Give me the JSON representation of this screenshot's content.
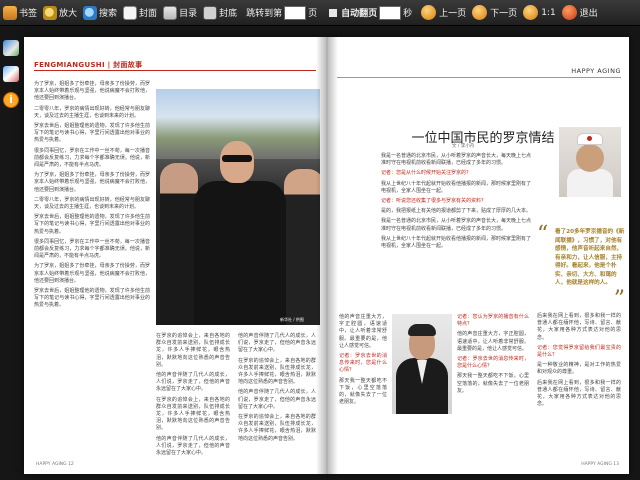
{
  "toolbar": {
    "bookmark": "书签",
    "zoom": "放大",
    "search": "搜索",
    "front_cover": "封面",
    "toc": "目录",
    "back_cover": "封底",
    "jump_to": "跳转到第",
    "page_value": "",
    "page_unit": "页",
    "auto_flip": "自动翻页",
    "auto_value": "",
    "seconds_unit": "秒",
    "prev": "上一页",
    "next": "下一页",
    "ratio": "1:1",
    "exit": "退出"
  },
  "rail": {
    "info": "i"
  },
  "left_page": {
    "header": "FENGMIANGUSHI | 封面故事",
    "col1": [
      "为了罗京，姐姐多了份牵挂，母亲多了份操劳，而罗京本人始终带着乐观与坚强，他说病魔不会打败他，他还要回到演播台。",
      "二零零八年，罗京的病情出现好转，他经常与朋友聊天，谈及过去的主播生涯，也谈到未来的计划。",
      "罗京去世后，姐姐整理他的遗物，发现了许多他生前写下的笔记与读书心得，字里行间透露出他对事业的热爱与执着。",
      "很多同事回忆，罗京在工作中一丝不苟，每一次播音前都会反复练习，力求每个字都准确无误。他说，新闻是严肃的，不能有半点马虎。"
    ],
    "col2": [
      "在罗京的追悼会上，来自各地的群众自发前来送别，队伍排成长龙，许多人手捧鲜花，眼含热泪，默默地向这位熟悉的声音告别。",
      "他的声音伴随了几代人的成长，人们说，罗京走了，但他的声音永远留在了大家心中。"
    ],
    "photo_credit": "新华社 / 供图",
    "page_number": "HAPPY AGING 12"
  },
  "right_page": {
    "header": "HAPPY AGING",
    "title": "一位中国市民的罗京情结",
    "byline": "文 / 李小舟",
    "col1": [
      "我是一名普通的北京市民，从小听着罗京的声音长大，每天晚上七点准时守在电视机前收看新闻联播，已经成了多年的习惯。",
      "记者：您是从什么时候开始关注罗京的？",
      "我从上世纪八十年代起就开始收看他播报的新闻，那时候家里刚有了电视机，全家人围坐在一起。",
      "记者：听说您还收集了很多与罗京有关的资料？",
      "是的，我把报纸上有关他的报道都剪了下来，贴成了厚厚的几大本。"
    ],
    "pullquote": "看了20多年罗京播音的《新闻联播》，习惯了，对他有感情，他声音听起来自然，有亲和力，让人信服，主持得好。看起来，他是个朴实、亲切、大方、和蔼的人，他就是这样的人。",
    "col2": [
      "记者：您认为罗京的播音有什么特点？",
      "他的声音庄重大方，字正腔圆，语速适中，让人听着非常舒服。最重要的是，他让人感觉可信。",
      "记者：罗京去世的消息传来时，您是什么心情？",
      "那天我一整天都吃不下饭，心里空落落的，就像失去了一位老朋友。"
    ],
    "col3": [
      "后来我在网上看到，很多和我一样的普通人都在缅怀他，写诗、留言、献花，大家用各种方式表达对他的思念。",
      "记者：您觉得罗京留给我们最宝贵的是什么？",
      "是一种敬业的精神，是对工作的热爱和对观众的尊重。"
    ],
    "page_number": "HAPPY AGING 13"
  }
}
